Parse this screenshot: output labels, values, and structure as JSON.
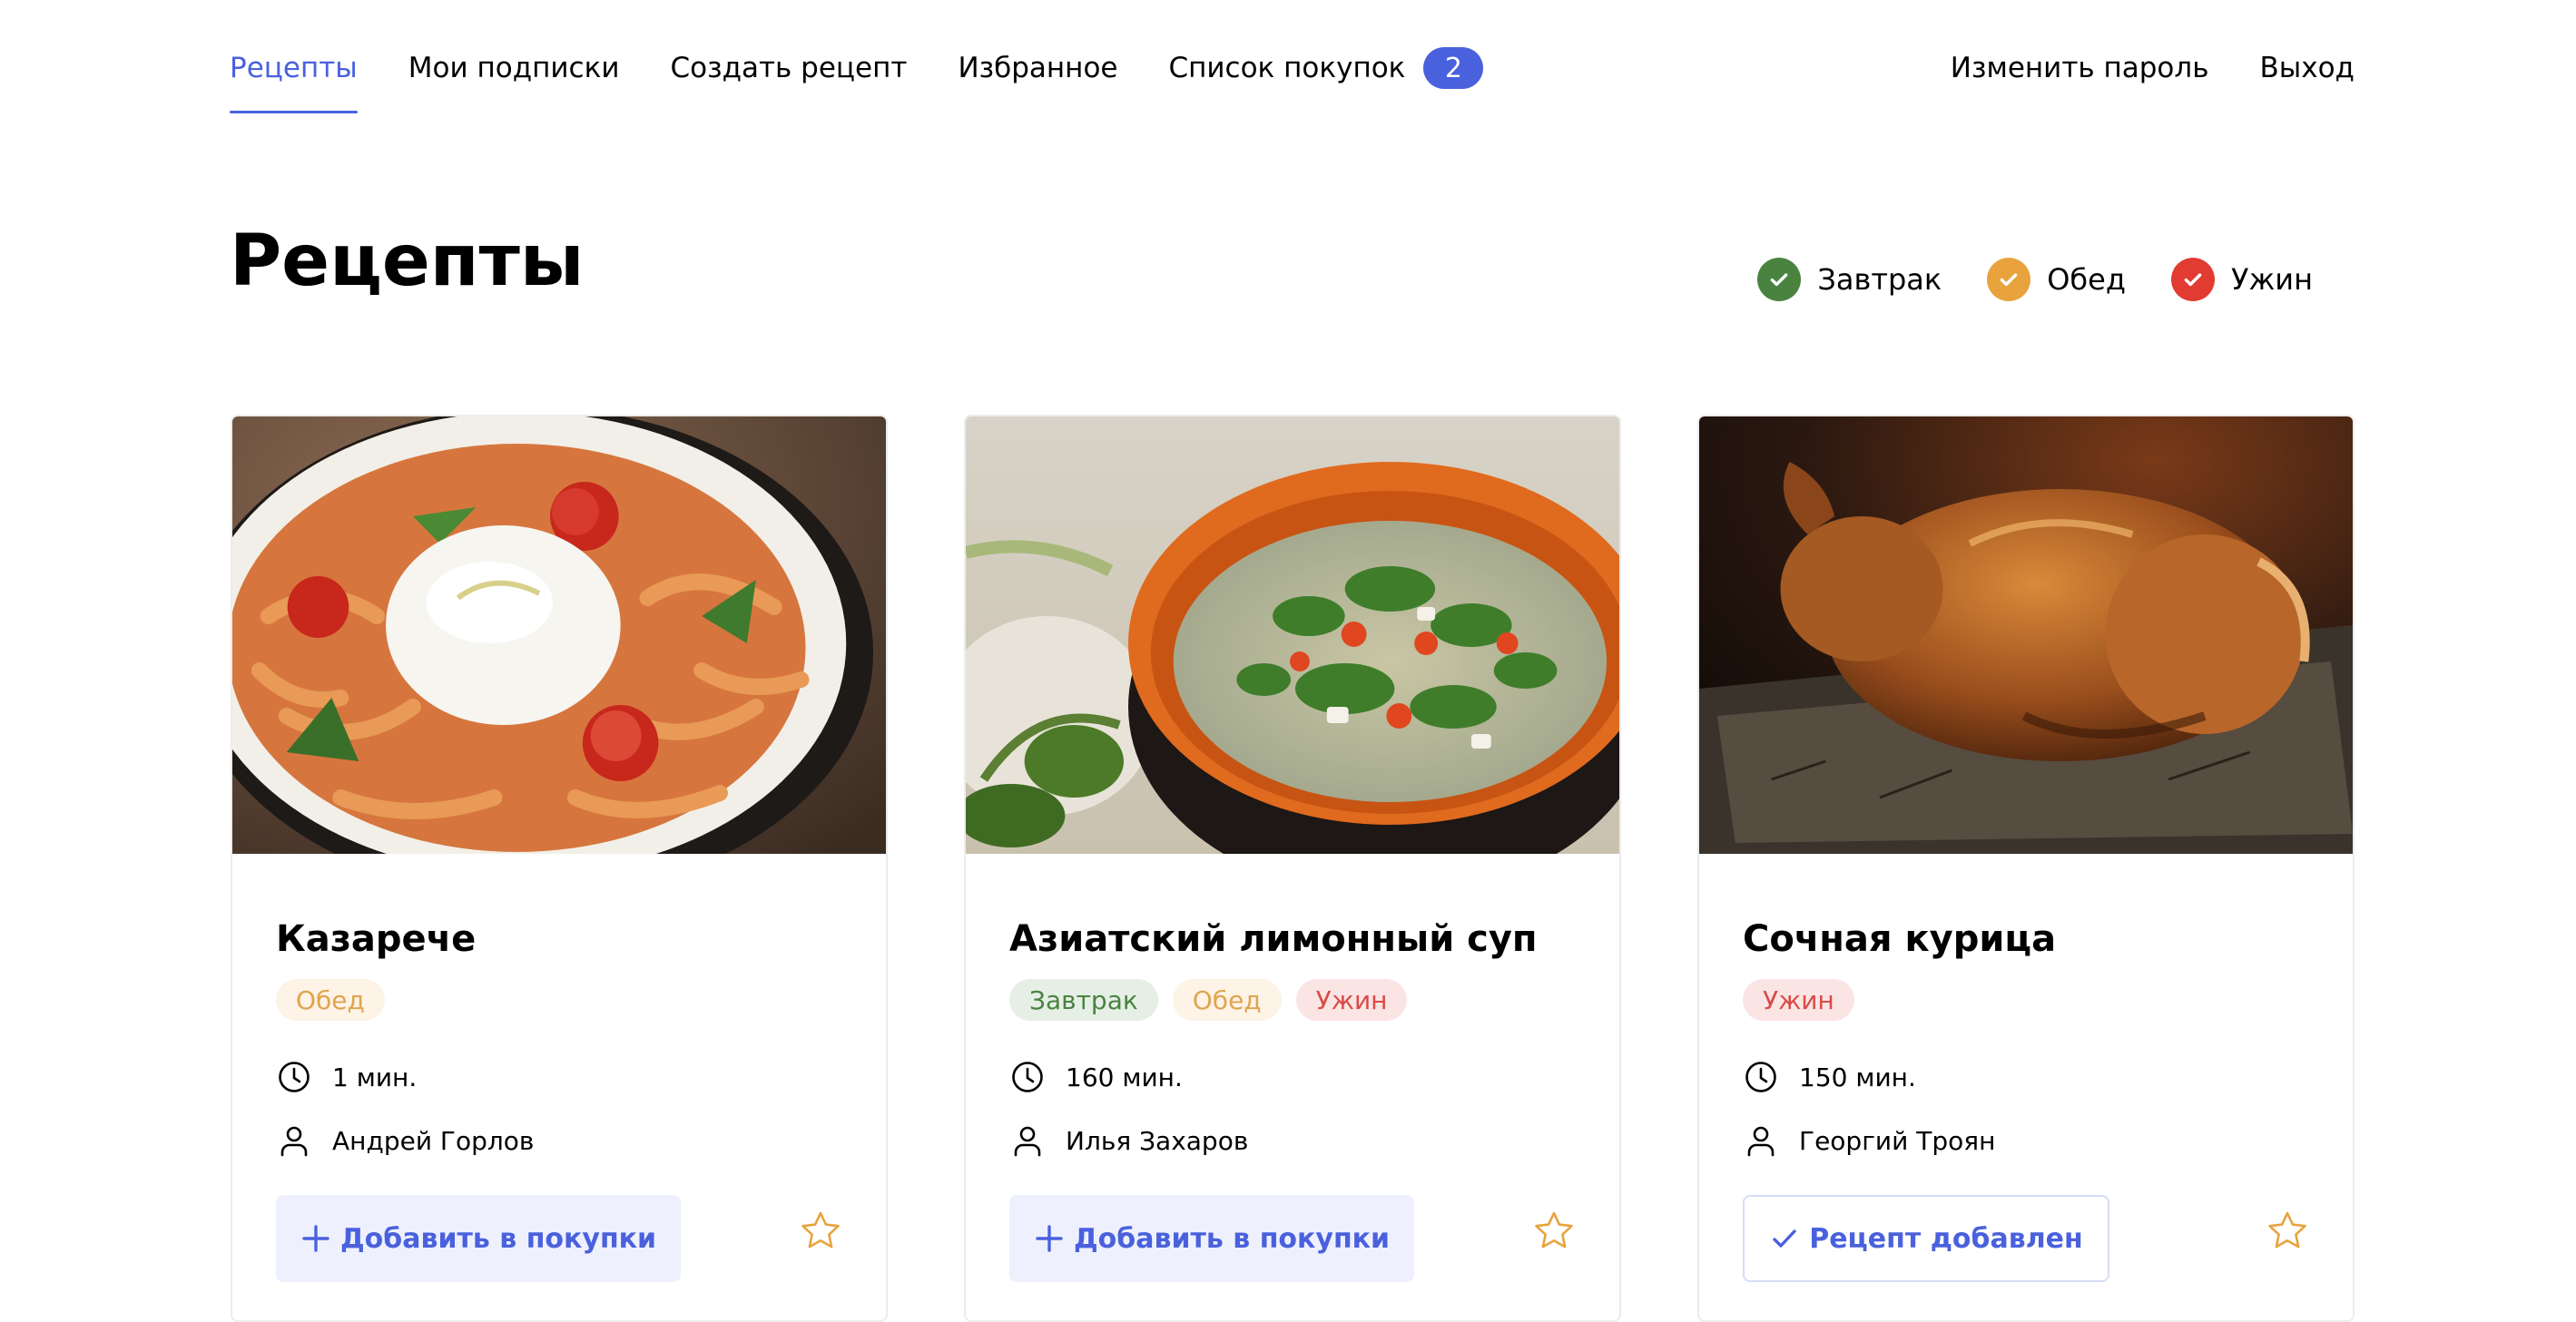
{
  "nav": {
    "recipes": "Рецепты",
    "subscriptions": "Мои подписки",
    "create": "Создать рецепт",
    "favorites": "Избранное",
    "shopping_list": "Список покупок",
    "cart_count": "2",
    "change_password": "Изменить пароль",
    "logout": "Выход"
  },
  "page": {
    "title": "Рецепты"
  },
  "filters": [
    {
      "label": "Завтрак",
      "color": "#49833f",
      "checked": true
    },
    {
      "label": "Обед",
      "color": "#e8a33d",
      "checked": true
    },
    {
      "label": "Ужин",
      "color": "#e23b32",
      "checked": true
    }
  ],
  "colors": {
    "accent": "#4a61dd",
    "breakfast": "#49833f",
    "lunch": "#e0a44e",
    "dinner": "#d94b47",
    "star": "#e8a33d"
  },
  "cards": [
    {
      "title": "Казарече",
      "image": "pasta-with-burrata-photo",
      "tags": [
        "Обед"
      ],
      "time": "1 мин.",
      "author": "Андрей Горлов",
      "button": "Добавить в покупки",
      "button_icon": "plus-icon",
      "favorite": false
    },
    {
      "title": "Азиатский лимонный суп",
      "image": "asian-soup-photo",
      "tags": [
        "Завтрак",
        "Обед",
        "Ужин"
      ],
      "time": "160 мин.",
      "author": "Илья Захаров",
      "button": "Добавить в покупки",
      "button_icon": "plus-icon",
      "favorite": false
    },
    {
      "title": "Сочная курица",
      "image": "roast-chicken-photo",
      "tags": [
        "Ужин"
      ],
      "time": "150 мин.",
      "author": "Георгий Троян",
      "button": "Рецепт добавлен",
      "button_icon": "check-icon",
      "favorite": false
    }
  ]
}
